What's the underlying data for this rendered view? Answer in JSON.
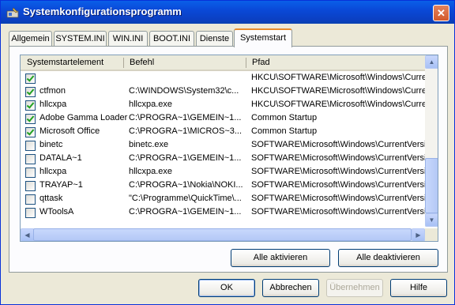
{
  "window": {
    "title": "Systemkonfigurationsprogramm",
    "close_glyph": "✕"
  },
  "tabs": [
    {
      "label": "Allgemein"
    },
    {
      "label": "SYSTEM.INI"
    },
    {
      "label": "WIN.INI"
    },
    {
      "label": "BOOT.INI"
    },
    {
      "label": "Dienste"
    },
    {
      "label": "Systemstart",
      "active": true
    }
  ],
  "list": {
    "columns": [
      "Systemstartelement",
      "Befehl",
      "Pfad"
    ],
    "rows": [
      {
        "checked": true,
        "name": "",
        "command": "",
        "path": "HKCU\\SOFTWARE\\Microsoft\\Windows\\CurrentV"
      },
      {
        "checked": true,
        "name": "ctfmon",
        "command": "C:\\WINDOWS\\System32\\c...",
        "path": "HKCU\\SOFTWARE\\Microsoft\\Windows\\CurrentV"
      },
      {
        "checked": true,
        "name": "hllcxpa",
        "command": "hllcxpa.exe",
        "path": "HKCU\\SOFTWARE\\Microsoft\\Windows\\CurrentV"
      },
      {
        "checked": true,
        "name": "Adobe Gamma Loader",
        "command": "C:\\PROGRA~1\\GEMEIN~1...",
        "path": "Common Startup"
      },
      {
        "checked": true,
        "name": "Microsoft Office",
        "command": "C:\\PROGRA~1\\MICROS~3...",
        "path": "Common Startup"
      },
      {
        "checked": false,
        "name": "binetc",
        "command": "binetc.exe",
        "path": "SOFTWARE\\Microsoft\\Windows\\CurrentVersio"
      },
      {
        "checked": false,
        "name": "DATALA~1",
        "command": "C:\\PROGRA~1\\GEMEIN~1...",
        "path": "SOFTWARE\\Microsoft\\Windows\\CurrentVersio"
      },
      {
        "checked": false,
        "name": "hllcxpa",
        "command": "hllcxpa.exe",
        "path": "SOFTWARE\\Microsoft\\Windows\\CurrentVersio"
      },
      {
        "checked": false,
        "name": "TRAYAP~1",
        "command": "C:\\PROGRA~1\\Nokia\\NOKI...",
        "path": "SOFTWARE\\Microsoft\\Windows\\CurrentVersio"
      },
      {
        "checked": false,
        "name": "qttask",
        "command": "\"C:\\Programme\\QuickTime\\...",
        "path": "SOFTWARE\\Microsoft\\Windows\\CurrentVersio"
      },
      {
        "checked": false,
        "name": "WToolsA",
        "command": "C:\\PROGRA~1\\GEMEIN~1...",
        "path": "SOFTWARE\\Microsoft\\Windows\\CurrentVersio"
      }
    ]
  },
  "panel_buttons": {
    "enable_all": "Alle aktivieren",
    "disable_all": "Alle deaktivieren"
  },
  "dialog_buttons": {
    "ok": "OK",
    "cancel": "Abbrechen",
    "apply": "Übernehmen",
    "help": "Hilfe"
  },
  "scroll_glyphs": {
    "up": "▲",
    "down": "▼",
    "left": "◀",
    "right": "▶"
  }
}
